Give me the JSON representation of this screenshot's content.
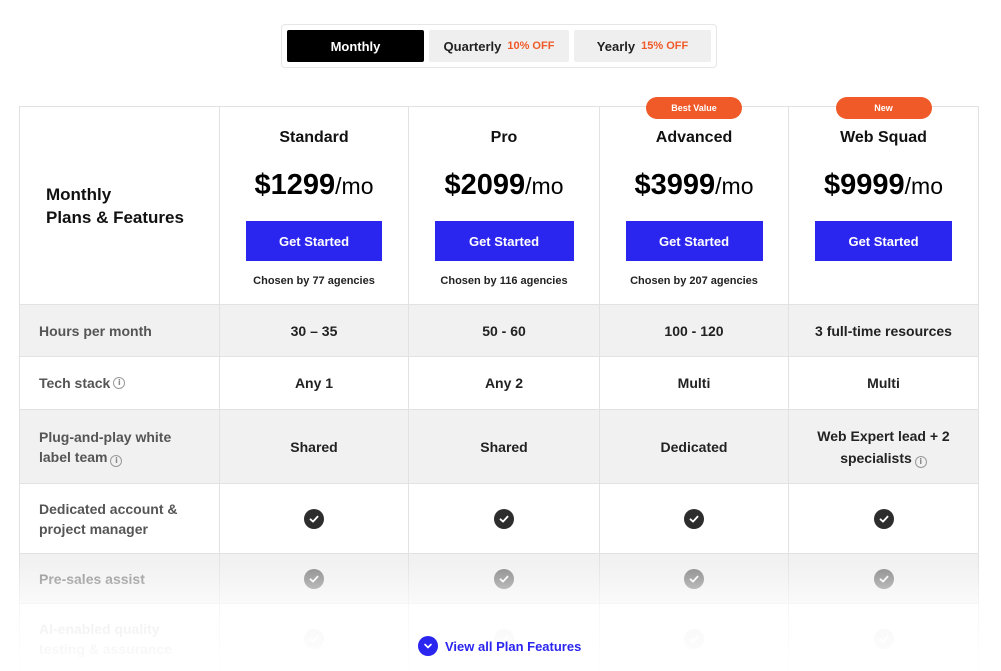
{
  "billing_toggle": {
    "monthly": {
      "label": "Monthly"
    },
    "quarterly": {
      "label": "Quarterly",
      "discount": "10% OFF"
    },
    "yearly": {
      "label": "Yearly",
      "discount": "15% OFF"
    },
    "selected": "monthly"
  },
  "table": {
    "heading_line1": "Monthly",
    "heading_line2": "Plans & Features",
    "plans": [
      {
        "name": "Standard",
        "price": "$1299",
        "period": "/mo",
        "cta": "Get Started",
        "chosen": "Chosen by 77 agencies",
        "badge": ""
      },
      {
        "name": "Pro",
        "price": "$2099",
        "period": "/mo",
        "cta": "Get Started",
        "chosen": "Chosen by 116 agencies",
        "badge": ""
      },
      {
        "name": "Advanced",
        "price": "$3999",
        "period": "/mo",
        "cta": "Get Started",
        "chosen": "Chosen by 207 agencies",
        "badge": "Best Value"
      },
      {
        "name": "Web Squad",
        "price": "$9999",
        "period": "/mo",
        "cta": "Get Started",
        "chosen": "",
        "badge": "New"
      }
    ],
    "features": {
      "hours": {
        "label": "Hours per month",
        "values": [
          "30 – 35",
          "50 - 60",
          "100 - 120",
          "3 full-time resources"
        ]
      },
      "tech": {
        "label": "Tech stack",
        "values": [
          "Any 1",
          "Any 2",
          "Multi",
          "Multi"
        ]
      },
      "team": {
        "label_line1": "Plug-and-play white",
        "label_line2": "label team",
        "values": [
          "Shared",
          "Shared",
          "Dedicated"
        ],
        "web_squad_line1": "Web Expert lead + 2",
        "web_squad_line2": "specialists"
      },
      "account": {
        "label_line1": "Dedicated account &",
        "label_line2": "project manager"
      },
      "presales": {
        "label": "Pre-sales assist"
      },
      "ai": {
        "label_line1": "AI-enabled quality",
        "label_line2": "testing & assurance"
      }
    }
  },
  "view_all": {
    "label": "View all Plan Features"
  },
  "colors": {
    "accent": "#2b25f0",
    "badge": "#f05a28",
    "active_toggle": "#000000"
  }
}
